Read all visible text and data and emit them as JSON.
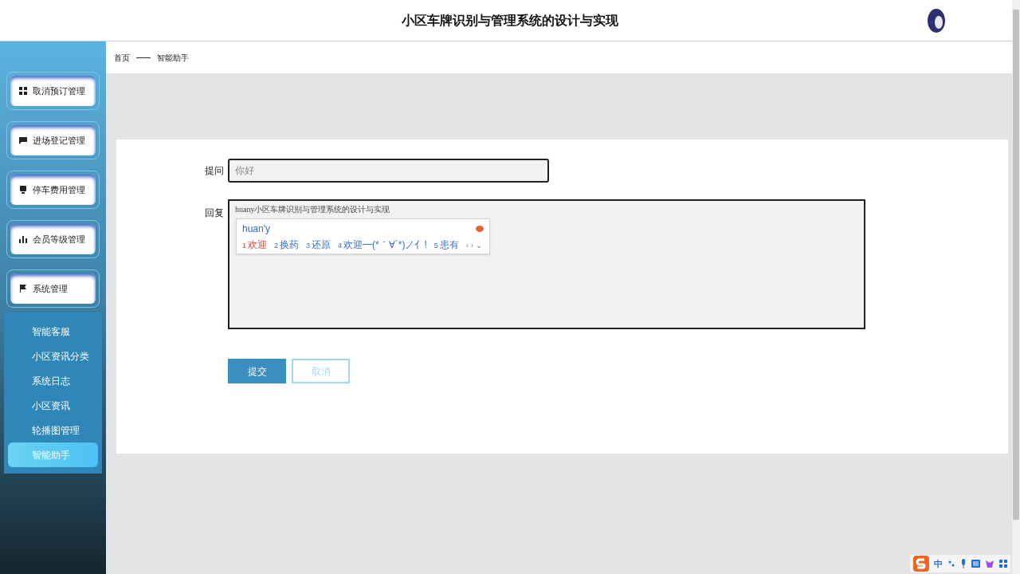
{
  "header": {
    "title": "小区车牌识别与管理系统的设计与实现"
  },
  "sidebar": {
    "menus": [
      {
        "label": "取消预订管理"
      },
      {
        "label": "进场登记管理"
      },
      {
        "label": "停车费用管理"
      },
      {
        "label": "会员等级管理"
      },
      {
        "label": "系统管理"
      }
    ],
    "submenu": [
      {
        "label": "智能客服",
        "selected": false
      },
      {
        "label": "小区资讯分类",
        "selected": false
      },
      {
        "label": "系统日志",
        "selected": false
      },
      {
        "label": "小区资讯",
        "selected": false
      },
      {
        "label": "轮播图管理",
        "selected": false
      },
      {
        "label": "智能助手",
        "selected": true
      }
    ]
  },
  "breadcrumb": [
    "首页",
    "智能助手"
  ],
  "form": {
    "question_label": "提问",
    "question_placeholder": "你好",
    "reply_label": "回复",
    "reply_value": "huany小区车牌识别与管理系统的设计与实现",
    "submit": "提交",
    "cancel": "取消"
  },
  "ime": {
    "composition": "huan'y",
    "candidates": [
      {
        "index": "1",
        "text": "欢迎",
        "selected": true
      },
      {
        "index": "2",
        "text": "换药",
        "selected": false
      },
      {
        "index": "3",
        "text": "还原",
        "selected": false
      },
      {
        "index": "4",
        "text": "欢迎━(*｀∀´*)ノ亻!",
        "selected": false
      },
      {
        "index": "5",
        "text": "患有",
        "selected": false
      }
    ],
    "page_buttons": "‹ › ⌄",
    "toolbar_mode": "中"
  }
}
